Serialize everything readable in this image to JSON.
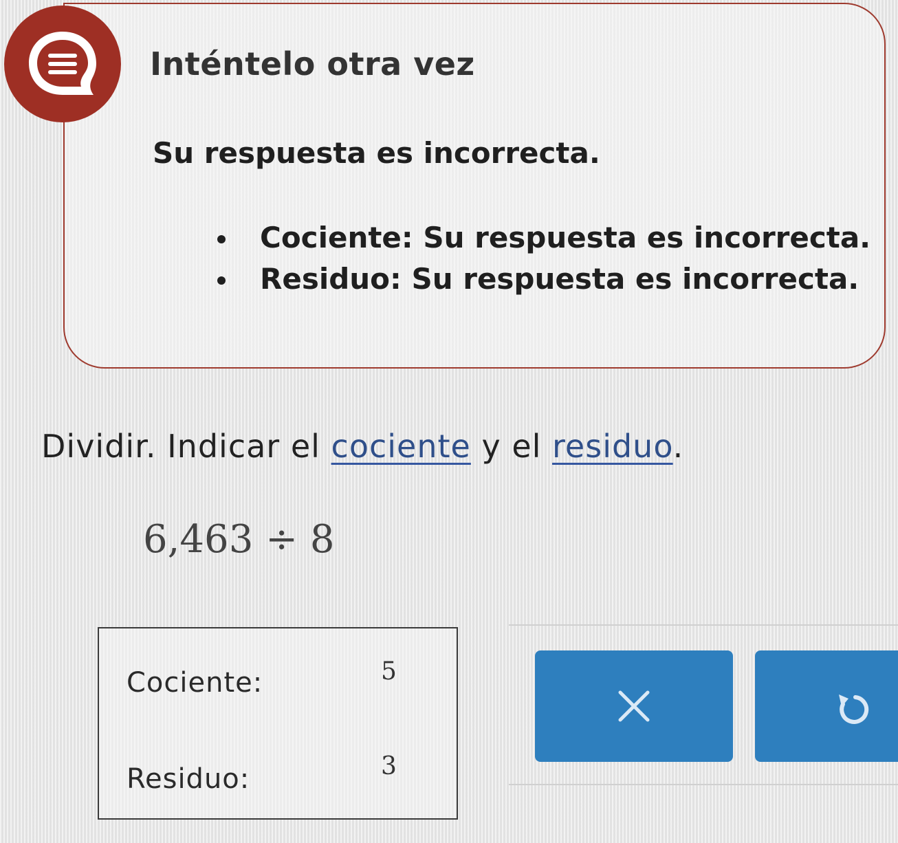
{
  "feedback": {
    "icon": "speech-bubble-icon",
    "title": "Inténtelo otra vez",
    "summary": "Su respuesta es incorrecta.",
    "items": [
      "Cociente: Su respuesta es incorrecta.",
      "Residuo: Su respuesta es incorrecta."
    ],
    "accent_color": "#9e2f24"
  },
  "problem": {
    "instruction_before": "Dividir. Indicar el ",
    "link_quotient": "cociente",
    "instruction_middle": " y el ",
    "link_remainder": "residuo",
    "instruction_end": ".",
    "expression": "6,463 ÷ 8"
  },
  "answers": {
    "quotient_label": "Cociente:",
    "quotient_value": "5",
    "remainder_label": "Residuo:",
    "remainder_value": "3"
  },
  "actions": {
    "clear_icon": "close-icon",
    "undo_icon": "undo-icon",
    "button_color": "#2e7fbe"
  }
}
